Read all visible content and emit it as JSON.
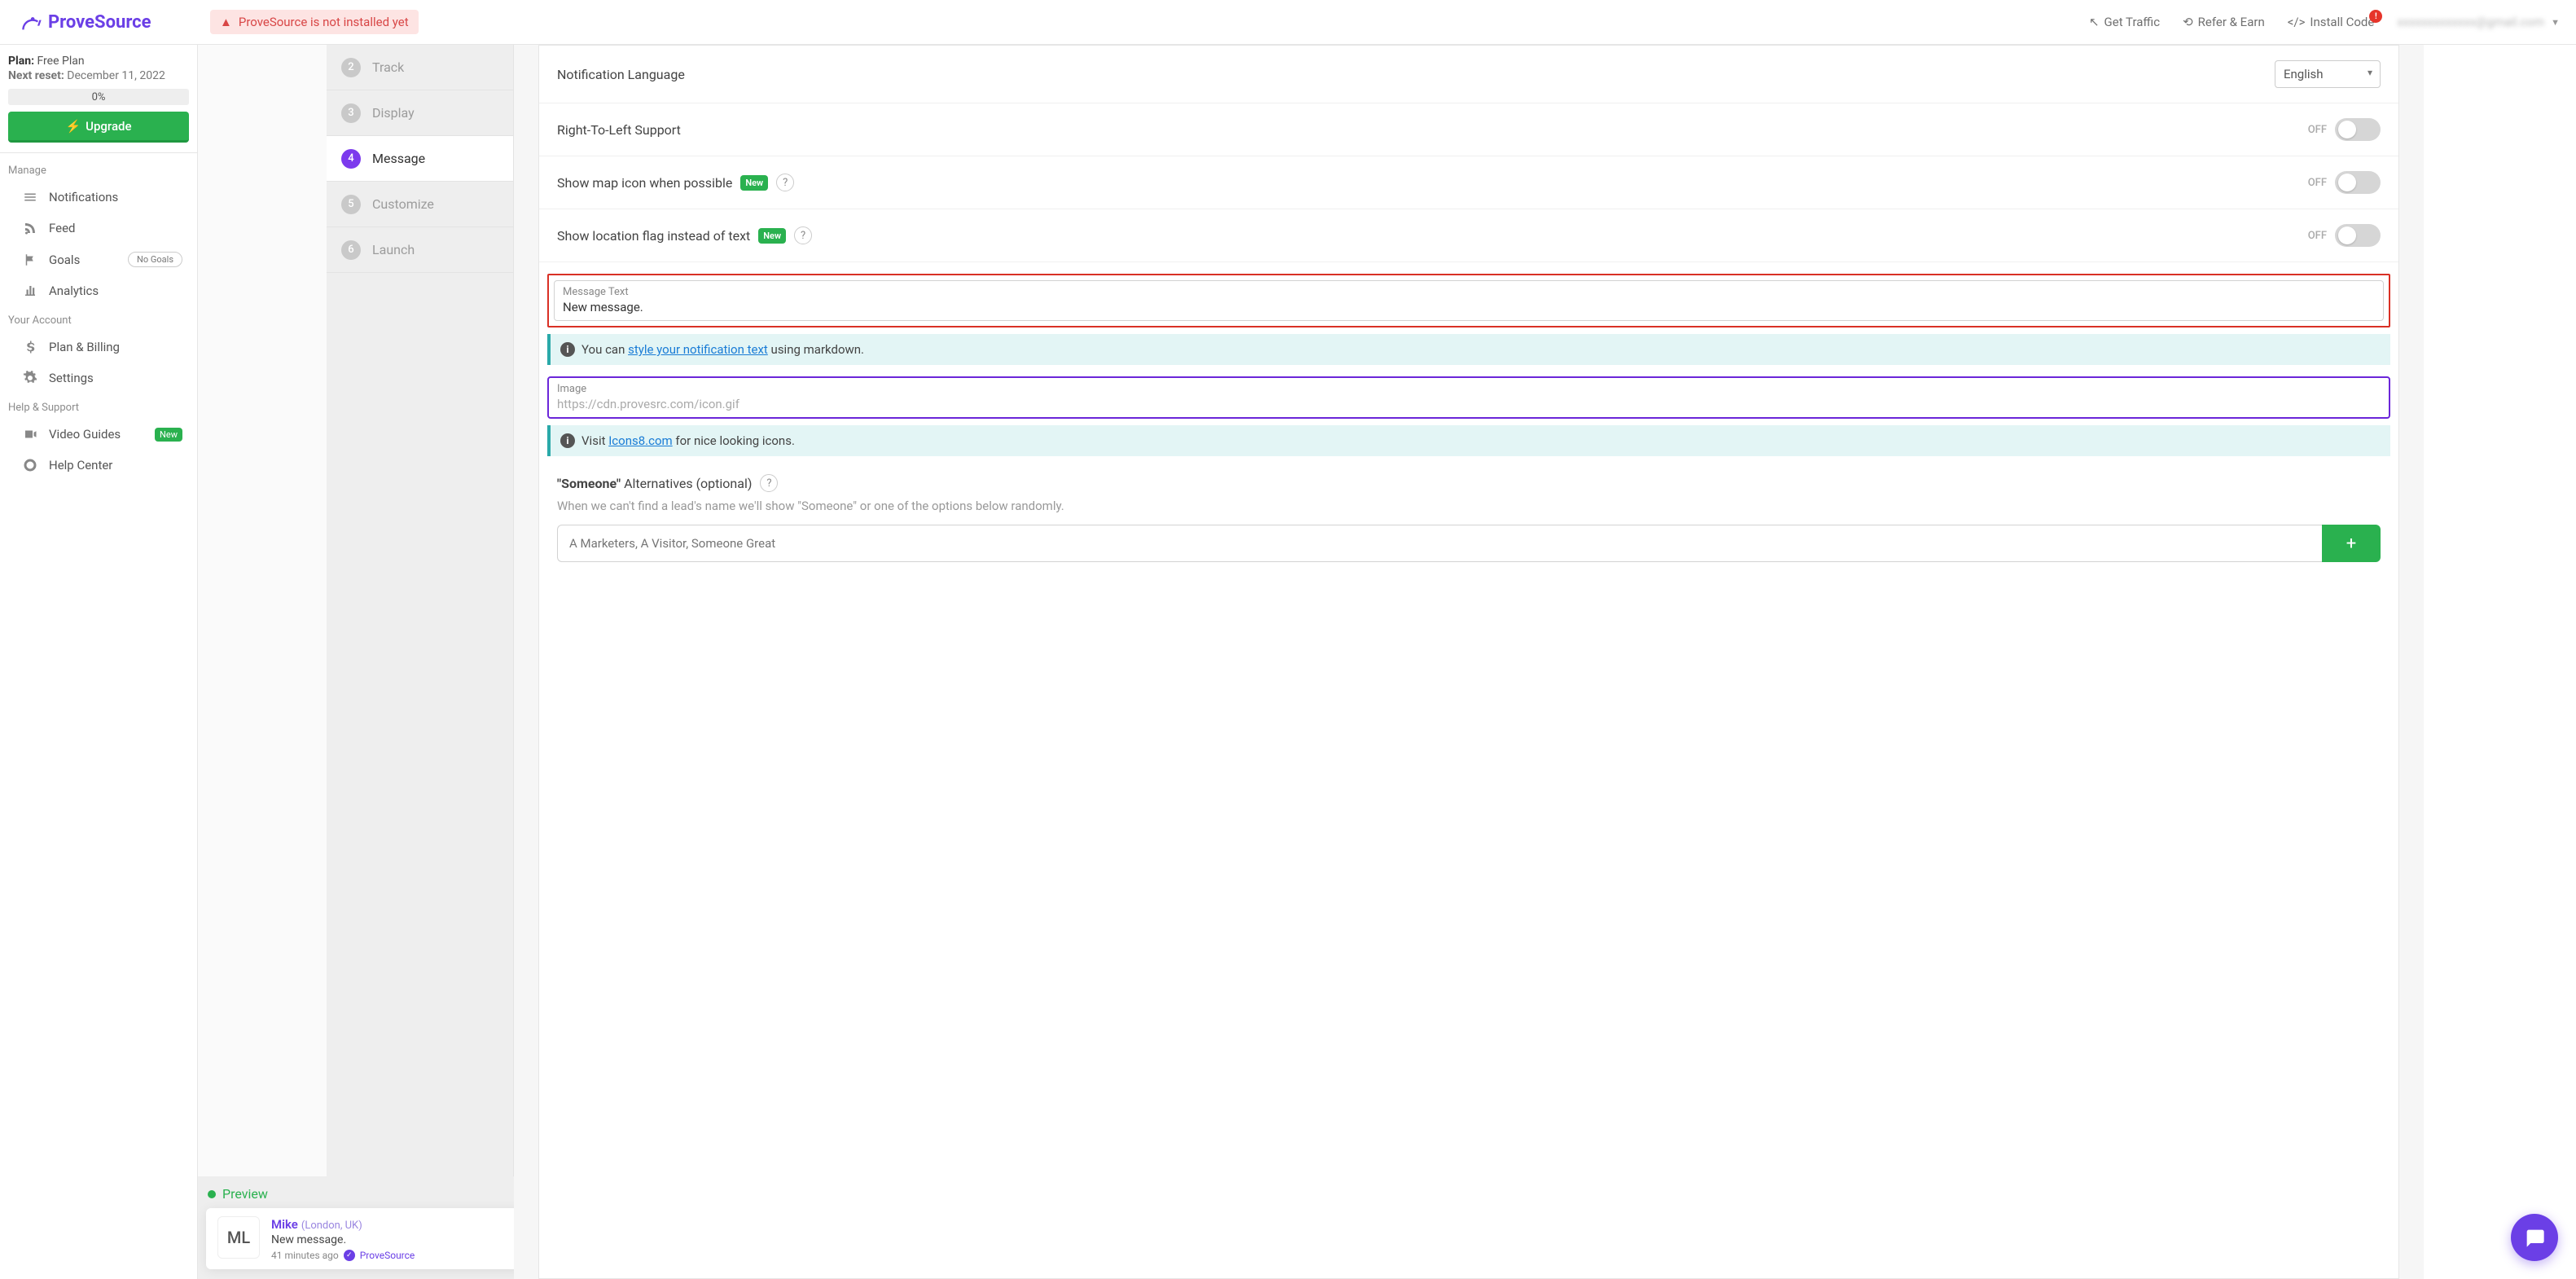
{
  "brand": "ProveSource",
  "install_banner": "ProveSource is not installed yet",
  "header_nav": {
    "traffic": "Get Traffic",
    "refer": "Refer & Earn",
    "install": "Install Code",
    "email": "xxxxxxxxxxxxx@gmail.com"
  },
  "plan": {
    "label": "Plan:",
    "value": "Free Plan",
    "reset_label": "Next reset:",
    "reset_value": "December 11, 2022",
    "progress": "0%",
    "upgrade": "Upgrade"
  },
  "sidebar": {
    "manage": "Manage",
    "notifications": "Notifications",
    "feed": "Feed",
    "goals": "Goals",
    "no_goals": "No Goals",
    "analytics": "Analytics",
    "account": "Your Account",
    "billing": "Plan & Billing",
    "settings": "Settings",
    "help": "Help & Support",
    "guides": "Video Guides",
    "new": "New",
    "helpcenter": "Help Center"
  },
  "steps": {
    "s2": "Track",
    "s3": "Display",
    "s4": "Message",
    "s5": "Customize",
    "s6": "Launch"
  },
  "form": {
    "lang_label": "Notification Language",
    "lang_value": "English",
    "rtl_label": "Right-To-Left Support",
    "map_label": "Show map icon when possible",
    "flag_label": "Show location flag instead of text",
    "new_badge": "New",
    "off": "OFF",
    "msg_field_label": "Message Text",
    "msg_field_value": "New message.",
    "info1_pre": "You can ",
    "info1_link": "style your notification text",
    "info1_post": " using markdown.",
    "img_label": "Image",
    "img_placeholder": "https://cdn.provesrc.com/icon.gif",
    "info2_pre": "Visit ",
    "info2_link": "Icons8.com",
    "info2_post": " for nice looking icons.",
    "someone_title_bold": "\"Someone\"",
    "someone_title_rest": " Alternatives (optional)",
    "someone_sub": "When we can't find a lead's name we'll show \"Someone\" or one of the options below randomly.",
    "someone_placeholder": "A Marketers, A Visitor, Someone Great"
  },
  "preview": {
    "title": "Preview",
    "initials": "ML",
    "name": "Mike",
    "location": "(London, UK)",
    "message": "New message.",
    "time": "41 minutes ago",
    "brand": "ProveSource"
  }
}
